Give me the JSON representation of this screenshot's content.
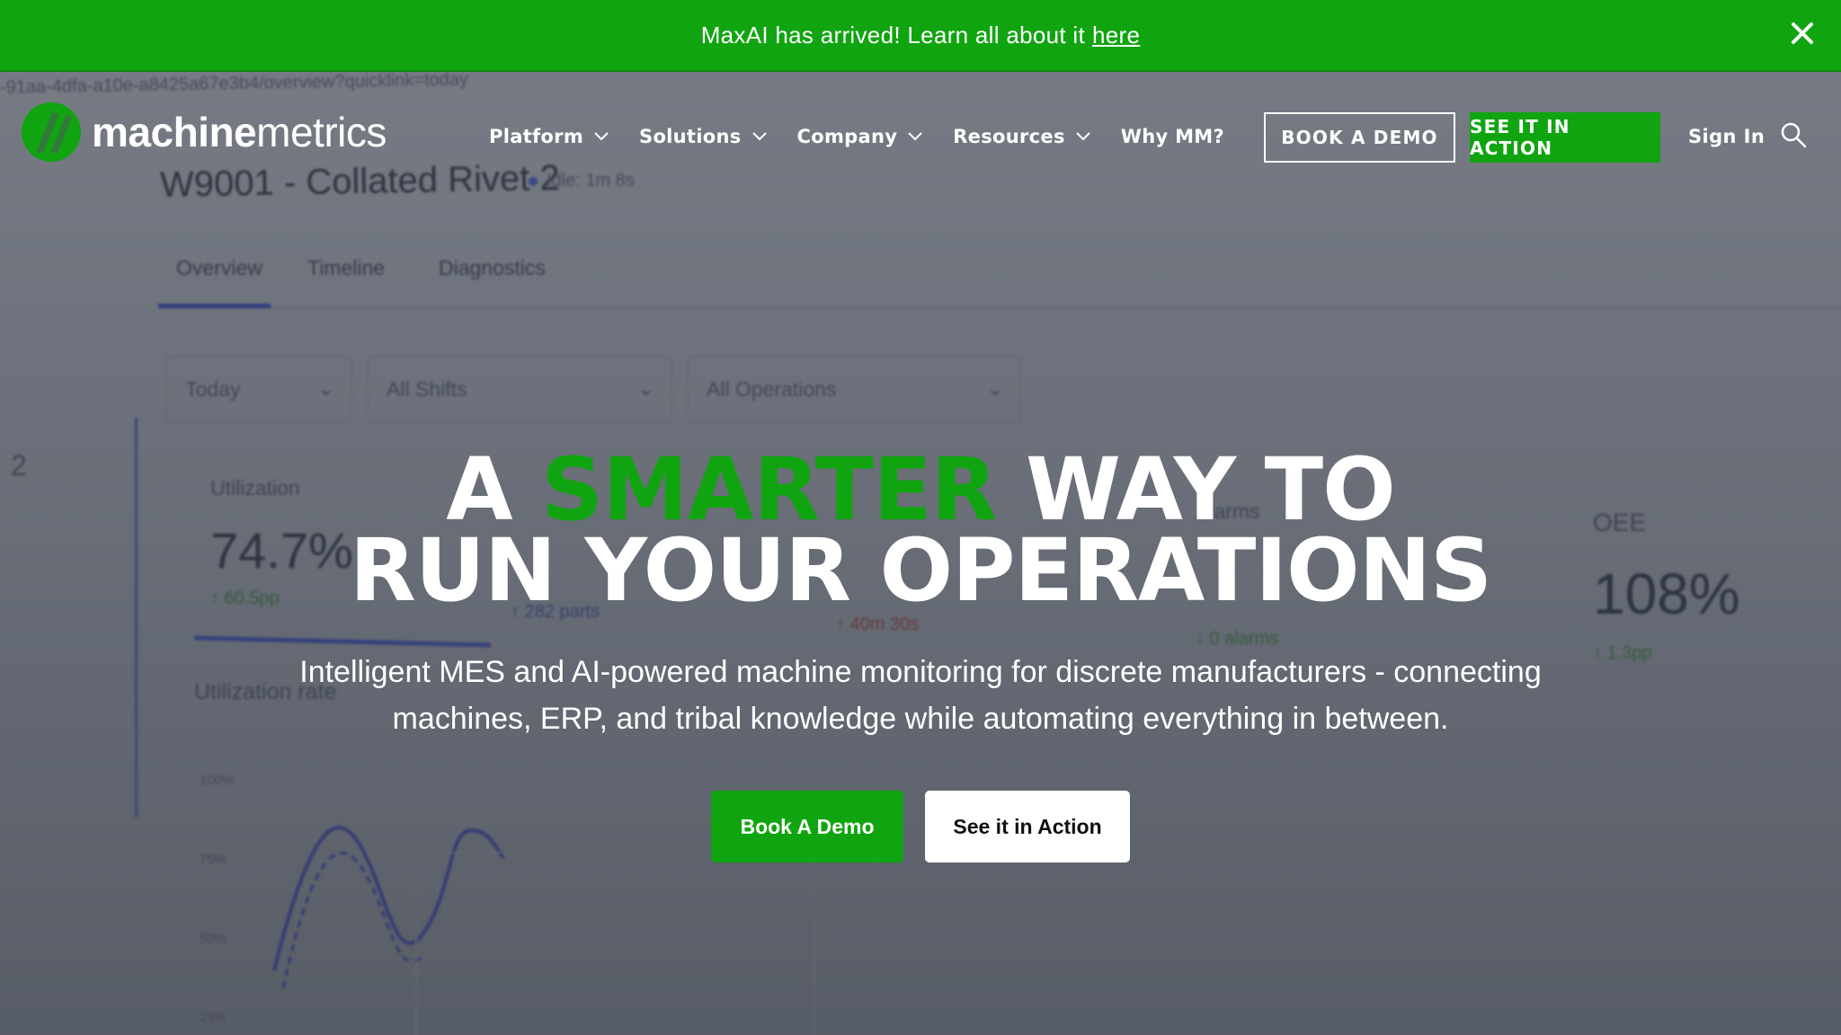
{
  "announcement": {
    "text": "MaxAI has arrived! Learn all about it",
    "link": "here",
    "close_icon": "close-icon"
  },
  "header": {
    "logo": {
      "bold": "machine",
      "light": "metrics",
      "icon": "machinemetrics-logo-icon"
    },
    "nav": [
      {
        "label": "Platform",
        "has_dropdown": true
      },
      {
        "label": "Solutions",
        "has_dropdown": true
      },
      {
        "label": "Company",
        "has_dropdown": true
      },
      {
        "label": "Resources",
        "has_dropdown": true
      },
      {
        "label": "Why MM?",
        "has_dropdown": false
      }
    ],
    "book_demo": "BOOK A DEMO",
    "see_in_action": "SEE IT IN ACTION",
    "sign_in": "Sign In",
    "search_icon": "search-icon"
  },
  "hero": {
    "headline_1_prefix": "A ",
    "headline_1_green": "SMARTER",
    "headline_1_suffix": " WAY TO",
    "headline_2": "RUN YOUR OPERATIONS",
    "subtext": "Intelligent MES and AI-powered machine monitoring for discrete manufacturers - connecting machines, ERP, and tribal knowledge while automating everything in between.",
    "cta_primary": "Book A Demo",
    "cta_secondary": "See it in Action"
  },
  "background_dashboard": {
    "url_fragment": "-91aa-4dfa-a10e-a8425a67e3b4/overview?quicklink=today",
    "title": "W9001 - Collated Rivet 2",
    "idle": "Idle: 1m 8s",
    "tabs": [
      "Overview",
      "Timeline",
      "Diagnostics"
    ],
    "selects": [
      "Today",
      "All Shifts",
      "All Operations"
    ],
    "utilization_label": "Utilization",
    "utilization_value": "74.7%",
    "utilization_delta": "↑ 60.5pp",
    "parts_delta": "↑ 282 parts",
    "downtime_delta": "↑ 40m 30s",
    "alarms_label": "Alarms",
    "alarms_delta": "↓ 0 alarms",
    "oee_label": "OEE",
    "oee_value": "108%",
    "oee_delta": "↑ 1.3pp",
    "utilization_rate_label": "Utilization rate",
    "axis_labels": [
      "100%",
      "75%",
      "50%",
      "25%"
    ],
    "side_number": "2"
  },
  "colors": {
    "brand_green": "#10a510",
    "white": "#ffffff"
  }
}
